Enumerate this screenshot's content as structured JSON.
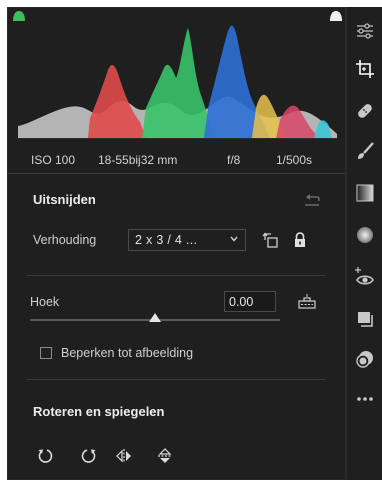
{
  "histogram": {
    "clip_shadow_color": "#6fd37a",
    "clip_highlight_color": "#f2f2f2"
  },
  "exif": {
    "iso": "ISO 100",
    "lens": "18-55bij32 mm",
    "aperture": "f/8",
    "shutter": "1/500s"
  },
  "crop": {
    "title": "Uitsnijden",
    "ratio_label": "Verhouding",
    "ratio_value": "2 x 3 / 4 ...",
    "angle_label": "Hoek",
    "angle_value": "0.00",
    "angle_level_fraction": 0.5,
    "constrain_label": "Beperken tot afbeelding",
    "constrain_checked": false
  },
  "rotate": {
    "title": "Roteren en spiegelen"
  },
  "toolbar": {
    "items": [
      "sliders-icon",
      "crop-icon",
      "healing-icon",
      "brush-icon",
      "gradient-icon",
      "radial-icon",
      "redeye-icon",
      "snapshots-icon",
      "presets-icon",
      "more-icon"
    ],
    "active": "crop-icon"
  },
  "colors": {
    "panel_bg": "#1f1f1f",
    "text": "#d6d6d6",
    "accent": "#ffffff"
  }
}
